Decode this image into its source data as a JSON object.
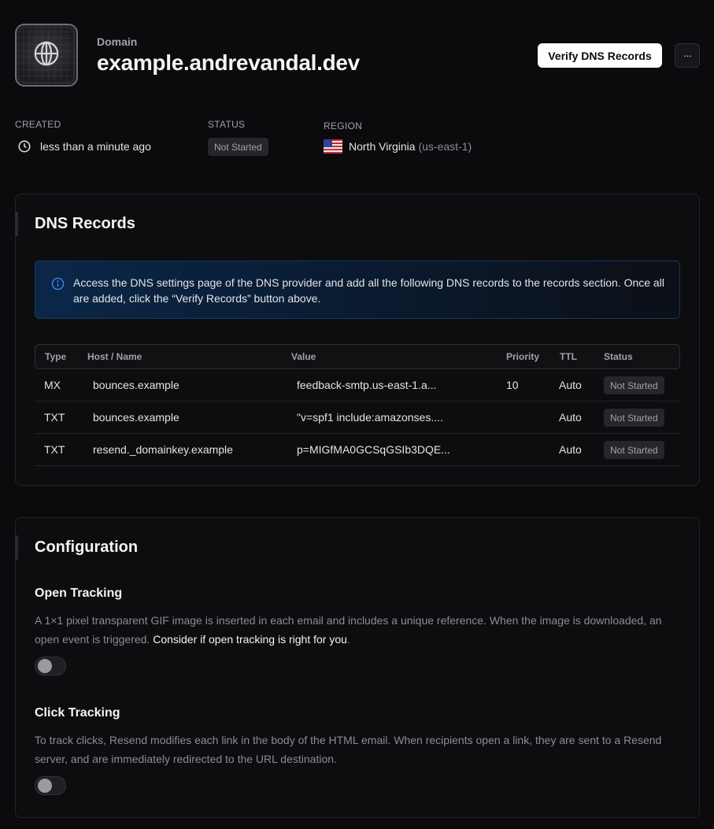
{
  "header": {
    "icon": "globe-icon",
    "eyebrow": "Domain",
    "title": "example.andrevandal.dev",
    "verify_button": "Verify DNS Records",
    "more_button": "···"
  },
  "meta": {
    "created": {
      "label": "CREATED",
      "value": "less than a minute ago",
      "icon": "clock-icon"
    },
    "status": {
      "label": "STATUS",
      "value": "Not Started"
    },
    "region": {
      "label": "REGION",
      "value": "North Virginia",
      "code": "(us-east-1)",
      "icon": "us-flag-icon"
    }
  },
  "dns": {
    "title": "DNS Records",
    "info": "Access the DNS settings page of the DNS provider and add all the following DNS records to the records section. Once all are added, click the “Verify Records” button above.",
    "columns": {
      "type": "Type",
      "host": "Host / Name",
      "value": "Value",
      "priority": "Priority",
      "ttl": "TTL",
      "status": "Status"
    },
    "rows": [
      {
        "type": "MX",
        "host": "bounces.example",
        "value": "feedback-smtp.us-east-1.a...",
        "priority": "10",
        "ttl": "Auto",
        "status": "Not Started"
      },
      {
        "type": "TXT",
        "host": "bounces.example",
        "value": "\"v=spf1 include:amazonses....",
        "priority": "",
        "ttl": "Auto",
        "status": "Not Started"
      },
      {
        "type": "TXT",
        "host": "resend._domainkey.example",
        "value": "p=MIGfMA0GCSqGSIb3DQE...",
        "priority": "",
        "ttl": "Auto",
        "status": "Not Started"
      }
    ]
  },
  "config": {
    "title": "Configuration",
    "open_tracking": {
      "title": "Open Tracking",
      "description": "A 1×1 pixel transparent GIF image is inserted in each email and includes a unique reference. When the image is downloaded, an open event is triggered.",
      "link": "Consider if open tracking is right for you",
      "period": ".",
      "enabled": false
    },
    "click_tracking": {
      "title": "Click Tracking",
      "description": "To track clicks, Resend modifies each link in the body of the HTML email. When recipients open a link, they are sent to a Resend server, and are immediately redirected to the URL destination.",
      "enabled": false
    }
  },
  "colors": {
    "background": "#0b0b0e",
    "primary_button": "#ffffff",
    "info_box": "#0b2748",
    "info_icon": "#3b82f6"
  }
}
